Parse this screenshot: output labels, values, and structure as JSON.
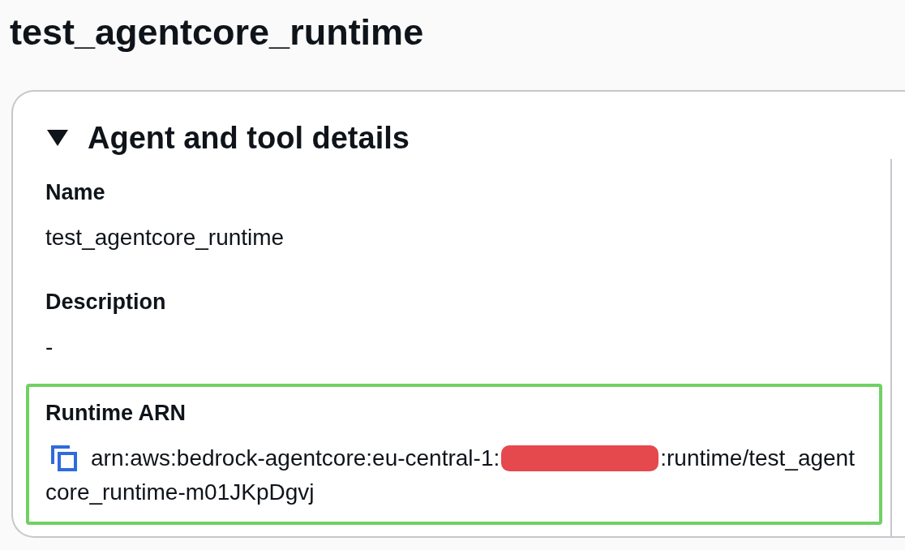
{
  "page_title": "test_agentcore_runtime",
  "section": {
    "title": "Agent and tool details",
    "expanded": true,
    "fields": [
      {
        "kind": "text",
        "label": "Name",
        "value": "test_agentcore_runtime",
        "highlighted": false
      },
      {
        "kind": "text",
        "label": "Description",
        "value": "-",
        "highlighted": false
      },
      {
        "kind": "copyable",
        "label": "Runtime ARN",
        "highlighted": true,
        "lines": [
          {
            "segments": [
              {
                "kind": "text",
                "text": "arn:aws:bedrock-agentcore:eu-central-1:"
              },
              {
                "kind": "redacted"
              },
              {
                "kind": "text",
                "text": ":runtime/test_agent"
              }
            ]
          },
          {
            "segments": [
              {
                "kind": "text",
                "text": "core_runtime-m01JKpDgvj"
              }
            ]
          }
        ]
      }
    ]
  }
}
